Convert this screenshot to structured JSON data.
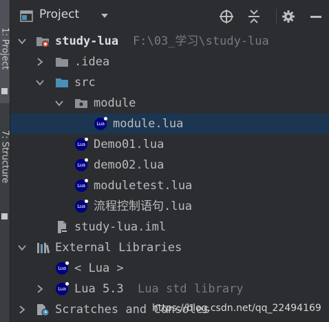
{
  "sidebar": {
    "tabs": [
      {
        "label": "1: Project",
        "active": true
      },
      {
        "label": "7: Structure",
        "active": false
      }
    ]
  },
  "header": {
    "title": "Project",
    "buttons": [
      "locate-icon",
      "collapse-all-icon",
      "gear-icon",
      "minimize-icon"
    ]
  },
  "tree": [
    {
      "label": "study-lua",
      "hint": "F:\\03_学习\\study-lua",
      "icon": "module-folder-icon",
      "expanded": true
    },
    {
      "label": ".idea",
      "icon": "folder-icon",
      "expanded": false
    },
    {
      "label": "src",
      "icon": "source-folder-icon",
      "expanded": true
    },
    {
      "label": "module",
      "icon": "package-folder-icon",
      "expanded": true
    },
    {
      "label": "module.lua",
      "icon": "lua-file-icon",
      "selected": true
    },
    {
      "label": "Demo01.lua",
      "icon": "lua-file-icon"
    },
    {
      "label": "demo02.lua",
      "icon": "lua-file-icon"
    },
    {
      "label": "moduletest.lua",
      "icon": "lua-file-icon"
    },
    {
      "label": "流程控制语句.lua",
      "icon": "lua-file-icon"
    },
    {
      "label": "study-lua.iml",
      "icon": "iml-file-icon"
    },
    {
      "label": "External Libraries",
      "icon": "libraries-icon",
      "expanded": true
    },
    {
      "label": "< Lua >",
      "icon": "lua-file-icon"
    },
    {
      "label": "Lua 5.3",
      "hint": "Lua std library",
      "icon": "lua-file-icon",
      "expanded": false
    },
    {
      "label": "Scratches and Consoles",
      "icon": "scratches-icon",
      "expanded": false
    }
  ],
  "watermark": "https://blog.csdn.net/qq_22494169",
  "colors": {
    "background": "#2b2d30",
    "selection": "#1c3651",
    "lua_icon": "#000080",
    "folder": "#8c9096",
    "source_folder": "#4a8fb8"
  }
}
